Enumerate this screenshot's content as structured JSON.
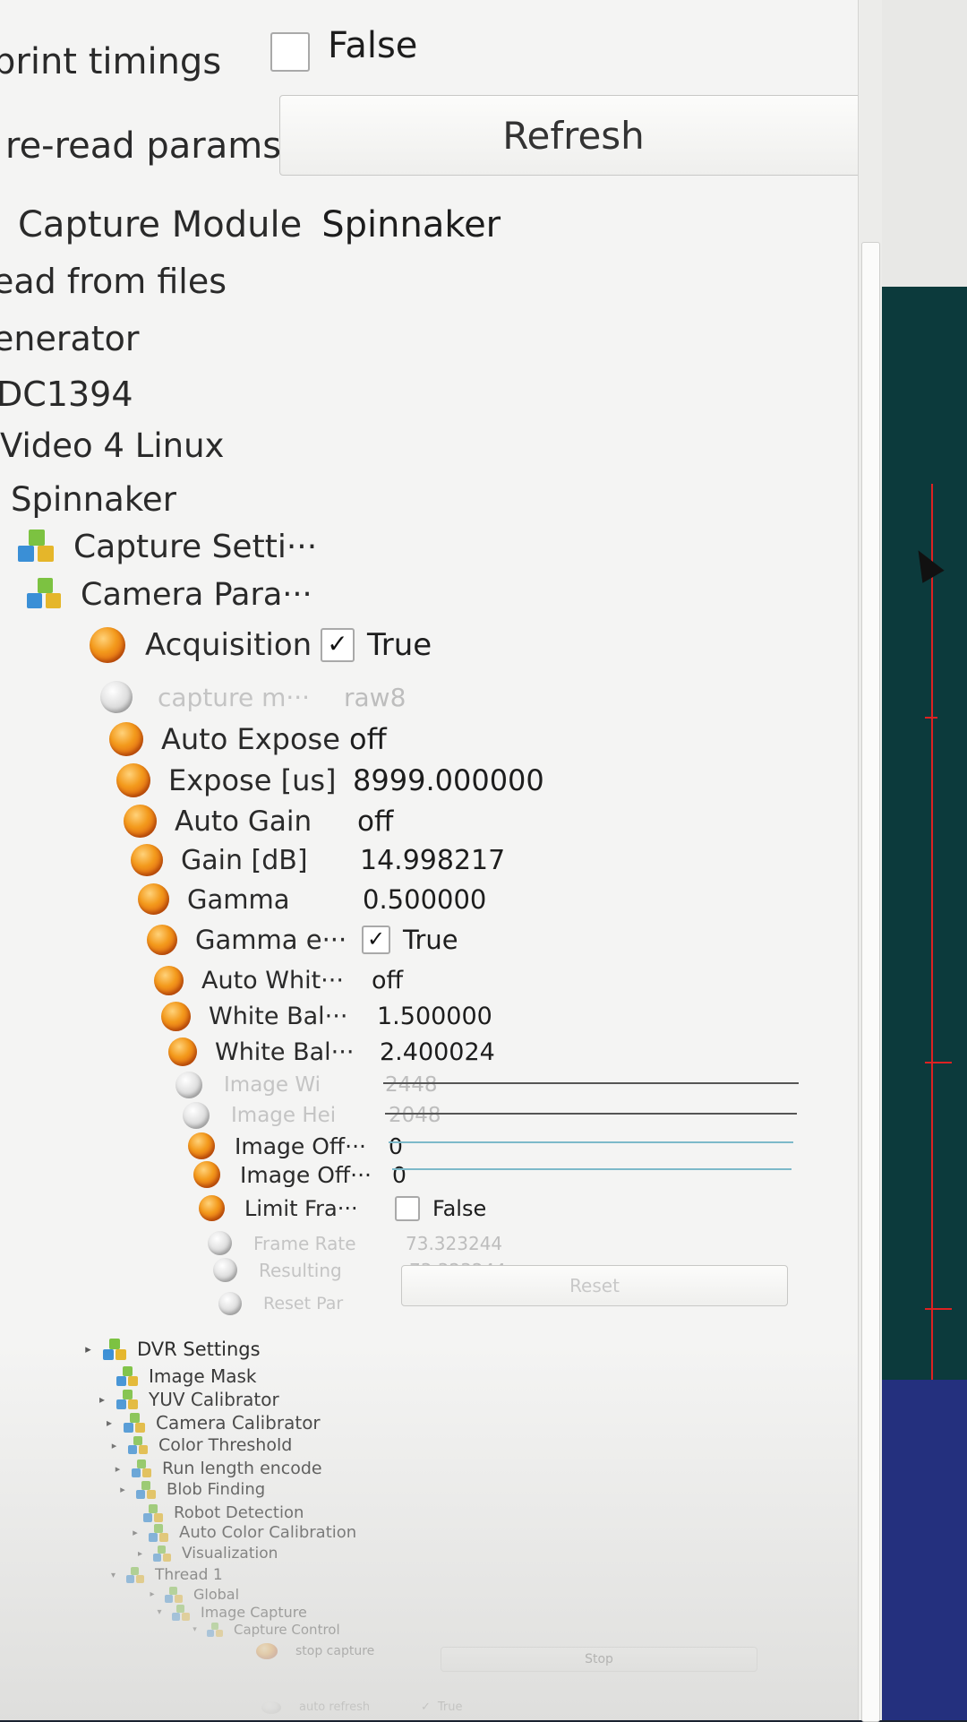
{
  "top_params": [
    {
      "label": "print timings",
      "value": "False"
    },
    {
      "label": "re-read params",
      "button": "Refresh"
    },
    {
      "label": "Capture Module",
      "value": "Spinnaker"
    }
  ],
  "modules": [
    "ead from files",
    "enerator",
    "DC1394",
    "Video 4 Linux",
    "Spinnaker"
  ],
  "groups": [
    "Capture Setti···",
    "Camera Para···"
  ],
  "camera_params": [
    {
      "label": "Acquisition",
      "value": "True",
      "checkbox": true,
      "checked": true
    },
    {
      "label": "capture m···",
      "value": "raw8",
      "disabled": true
    },
    {
      "label": "Auto Expose",
      "value": "off"
    },
    {
      "label": "Expose [us]",
      "value": "8999.000000"
    },
    {
      "label": "Auto Gain",
      "value": "off"
    },
    {
      "label": "Gain [dB]",
      "value": "14.998217"
    },
    {
      "label": "Gamma",
      "value": "0.500000"
    },
    {
      "label": "Gamma e···",
      "value": "True",
      "checkbox": true,
      "checked": true
    },
    {
      "label": "Auto Whit···",
      "value": "off"
    },
    {
      "label": "White Bal···",
      "value": "1.500000"
    },
    {
      "label": "White Bal···",
      "value": "2.400024"
    },
    {
      "label": "Image Wi",
      "value": "2448",
      "disabled": true
    },
    {
      "label": "Image Hei",
      "value": "2048",
      "disabled": true
    },
    {
      "label": "Image Off···",
      "value": "0"
    },
    {
      "label": "Image Off···",
      "value": "0"
    },
    {
      "label": "Limit Fra···",
      "value": "False",
      "checkbox": true,
      "checked": false
    },
    {
      "label": "Frame Rate",
      "value": "73.323244",
      "disabled": true
    },
    {
      "label": "Resulting",
      "value": "73.323244",
      "disabled": true
    },
    {
      "label": "Reset Par",
      "button": "Reset",
      "disabled": true
    }
  ],
  "tree": [
    {
      "label": "DVR Settings",
      "arrow": "▸"
    },
    {
      "label": "Image Mask",
      "arrow": ""
    },
    {
      "label": "YUV Calibrator",
      "arrow": "▸"
    },
    {
      "label": "Camera Calibrator",
      "arrow": "▸"
    },
    {
      "label": "Color Threshold",
      "arrow": "▸"
    },
    {
      "label": "Run length encode",
      "arrow": "▸"
    },
    {
      "label": "Blob Finding",
      "arrow": "▸"
    },
    {
      "label": "Robot Detection",
      "arrow": ""
    },
    {
      "label": "Auto Color Calibration",
      "arrow": "▸"
    },
    {
      "label": "Visualization",
      "arrow": "▸"
    },
    {
      "label": "Thread 1",
      "arrow": "▾"
    },
    {
      "label": "Global",
      "arrow": "▸"
    },
    {
      "label": "Image Capture",
      "arrow": "▾"
    },
    {
      "label": "Capture Control",
      "arrow": "▾"
    }
  ],
  "capture_control": [
    {
      "label": "stop capture",
      "button": "Stop"
    },
    {
      "label": "auto refresh",
      "value": "True"
    }
  ],
  "colors": {
    "accent_orange": "#f39a1c",
    "panel_bg": "#f4f4f3",
    "red_marker": "#d22"
  }
}
